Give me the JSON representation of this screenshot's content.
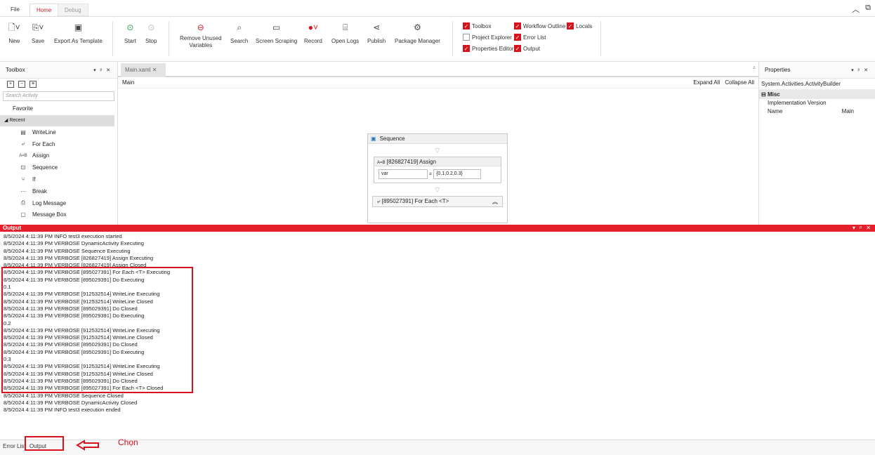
{
  "tabs": [
    "File",
    "Home",
    "Debug"
  ],
  "ribbon": {
    "new": "New",
    "save": "Save",
    "export": "Export As Template",
    "start": "Start",
    "stop": "Stop",
    "remove_unused": "Remove Unused\nVariables",
    "search": "Search",
    "screen_scraping": "Screen Scraping",
    "record": "Record",
    "open_logs": "Open Logs",
    "publish": "Publish",
    "package_manager": "Package Manager"
  },
  "checkboxes": {
    "toolbox": "Toolbox",
    "project_explorer": "Project Explorer",
    "properties_editor": "Properties Editor",
    "workflow_outline": "Workflow Outline",
    "error_list": "Error List",
    "output": "Output",
    "locals": "Locals"
  },
  "toolbox": {
    "title": "Toolbox",
    "search_placeholder": "Search Activity",
    "favorite": "Favorite",
    "recent": "Recent",
    "items": [
      "WriteLine",
      "For Each",
      "Assign",
      "Sequence",
      "If",
      "Break",
      "Log Message",
      "Message Box"
    ]
  },
  "designer": {
    "tab": "Main.xaml",
    "breadcrumb": "Main",
    "expand_all": "Expand All",
    "collapse_all": "Collapse All",
    "sequence_title": "Sequence",
    "assign_title": "[826827419] Assign",
    "assign_to": "var",
    "assign_eq": "=",
    "assign_value": "{0.1,0.2,0.3}",
    "foreach_title": "[895027391] For Each <T>"
  },
  "properties": {
    "title": "Properties",
    "type": "System.Activities.ActivityBuilder",
    "category": "Misc",
    "rows": [
      {
        "name": "Implementation Version",
        "value": ""
      },
      {
        "name": "Name",
        "value": "Main"
      }
    ]
  },
  "output": {
    "title": "Output",
    "lines": [
      "8/5/2024 4:11:39 PM INFO test3 execution started",
      "8/5/2024 4:11:39 PM VERBOSE DynamicActivity Executing",
      "8/5/2024 4:11:39 PM VERBOSE Sequence Executing",
      "8/5/2024 4:11:39 PM VERBOSE [826827419] Assign Executing",
      "8/5/2024 4:11:39 PM VERBOSE [826827419] Assign Closed",
      "8/5/2024 4:11:39 PM VERBOSE [895027391] For Each <T> Executing",
      "8/5/2024 4:11:39 PM VERBOSE [895029391] Do Executing",
      "0.1",
      "8/5/2024 4:11:39 PM VERBOSE [912532514] WriteLine Executing",
      "8/5/2024 4:11:39 PM VERBOSE [912532514] WriteLine Closed",
      "8/5/2024 4:11:39 PM VERBOSE [895029391] Do Closed",
      "8/5/2024 4:11:39 PM VERBOSE [895029391] Do Executing",
      "0.2",
      "8/5/2024 4:11:39 PM VERBOSE [912532514] WriteLine Executing",
      "8/5/2024 4:11:39 PM VERBOSE [912532514] WriteLine Closed",
      "8/5/2024 4:11:39 PM VERBOSE [895029391] Do Closed",
      "8/5/2024 4:11:39 PM VERBOSE [895029391] Do Executing",
      "0.3",
      "8/5/2024 4:11:39 PM VERBOSE [912532514] WriteLine Executing",
      "8/5/2024 4:11:39 PM VERBOSE [912532514] WriteLine Closed",
      "8/5/2024 4:11:39 PM VERBOSE [895029391] Do Closed",
      "8/5/2024 4:11:39 PM VERBOSE [895027391] For Each <T> Closed",
      "8/5/2024 4:11:39 PM VERBOSE Sequence Closed",
      "8/5/2024 4:11:39 PM VERBOSE DynamicActivity Closed",
      "8/5/2024 4:11:39 PM INFO test3 execution ended"
    ]
  },
  "bottom_tabs": [
    "Error List",
    "Output"
  ],
  "annotation": "Chọn",
  "colors": {
    "accent": "#d7121c",
    "output_bar": "#e5202a"
  }
}
